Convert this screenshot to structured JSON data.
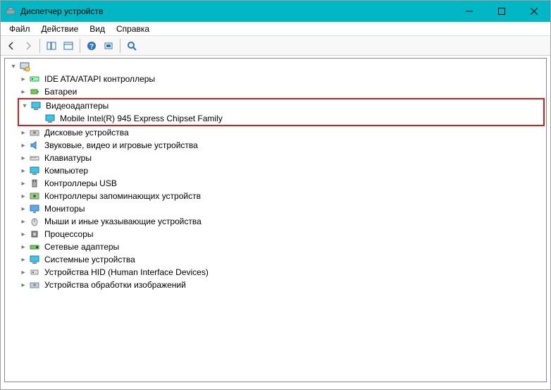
{
  "window": {
    "title": "Диспетчер устройств"
  },
  "menu": {
    "file": "Файл",
    "action": "Действие",
    "view": "Вид",
    "help": "Справка"
  },
  "tree": {
    "root": "",
    "ide": "IDE ATA/ATAPI контроллеры",
    "batteries": "Батареи",
    "display": "Видеоадаптеры",
    "display_child": "Mobile Intel(R) 945 Express Chipset Family",
    "disk": "Дисковые устройства",
    "sound": "Звуковые, видео и игровые устройства",
    "keyboard": "Клавиатуры",
    "computer": "Компьютер",
    "usb": "Контроллеры USB",
    "storage": "Контроллеры запоминающих устройств",
    "monitor": "Мониторы",
    "mouse": "Мыши и иные указывающие устройства",
    "processor": "Процессоры",
    "network": "Сетевые адаптеры",
    "system": "Системные устройства",
    "hid": "Устройства HID (Human Interface Devices)",
    "imaging": "Устройства обработки изображений"
  }
}
